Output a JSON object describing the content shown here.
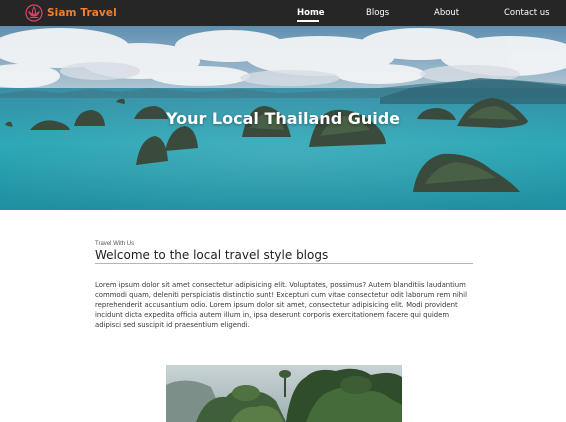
{
  "brand": {
    "name": "Siam Travel",
    "logo_icon": "lotus-icon",
    "accent_color": "#f07f2f"
  },
  "nav": {
    "items": [
      {
        "label": "Home",
        "active": true
      },
      {
        "label": "Blogs",
        "active": false
      },
      {
        "label": "About",
        "active": false
      },
      {
        "label": "Contact us",
        "active": false
      }
    ]
  },
  "hero": {
    "title": "Your Local Thailand Guide"
  },
  "intro": {
    "eyebrow": "Travel With Us",
    "title": "Welcome to the local travel style blogs",
    "body": "Lorem ipsum dolor sit amet consectetur adipisicing elit. Voluptates, possimus? Autem blanditiis laudantium commodi quam, deleniti perspiciatis distinctio sunt! Excepturi cum vitae consectetur odit laborum rem nihil reprehenderit accusantium odio. Lorem ipsum dolor sit amet, consectetur adipisicing elit. Modi provident incidunt dicta expedita officia autem illum in, ipsa deserunt corporis exercitationem facere qui quidem adipisci sed suscipit id praesentium eligendi."
  },
  "colors": {
    "navbar_bg": "#262626",
    "sea": "#2aa6b5",
    "text": "#3a3a3a"
  }
}
